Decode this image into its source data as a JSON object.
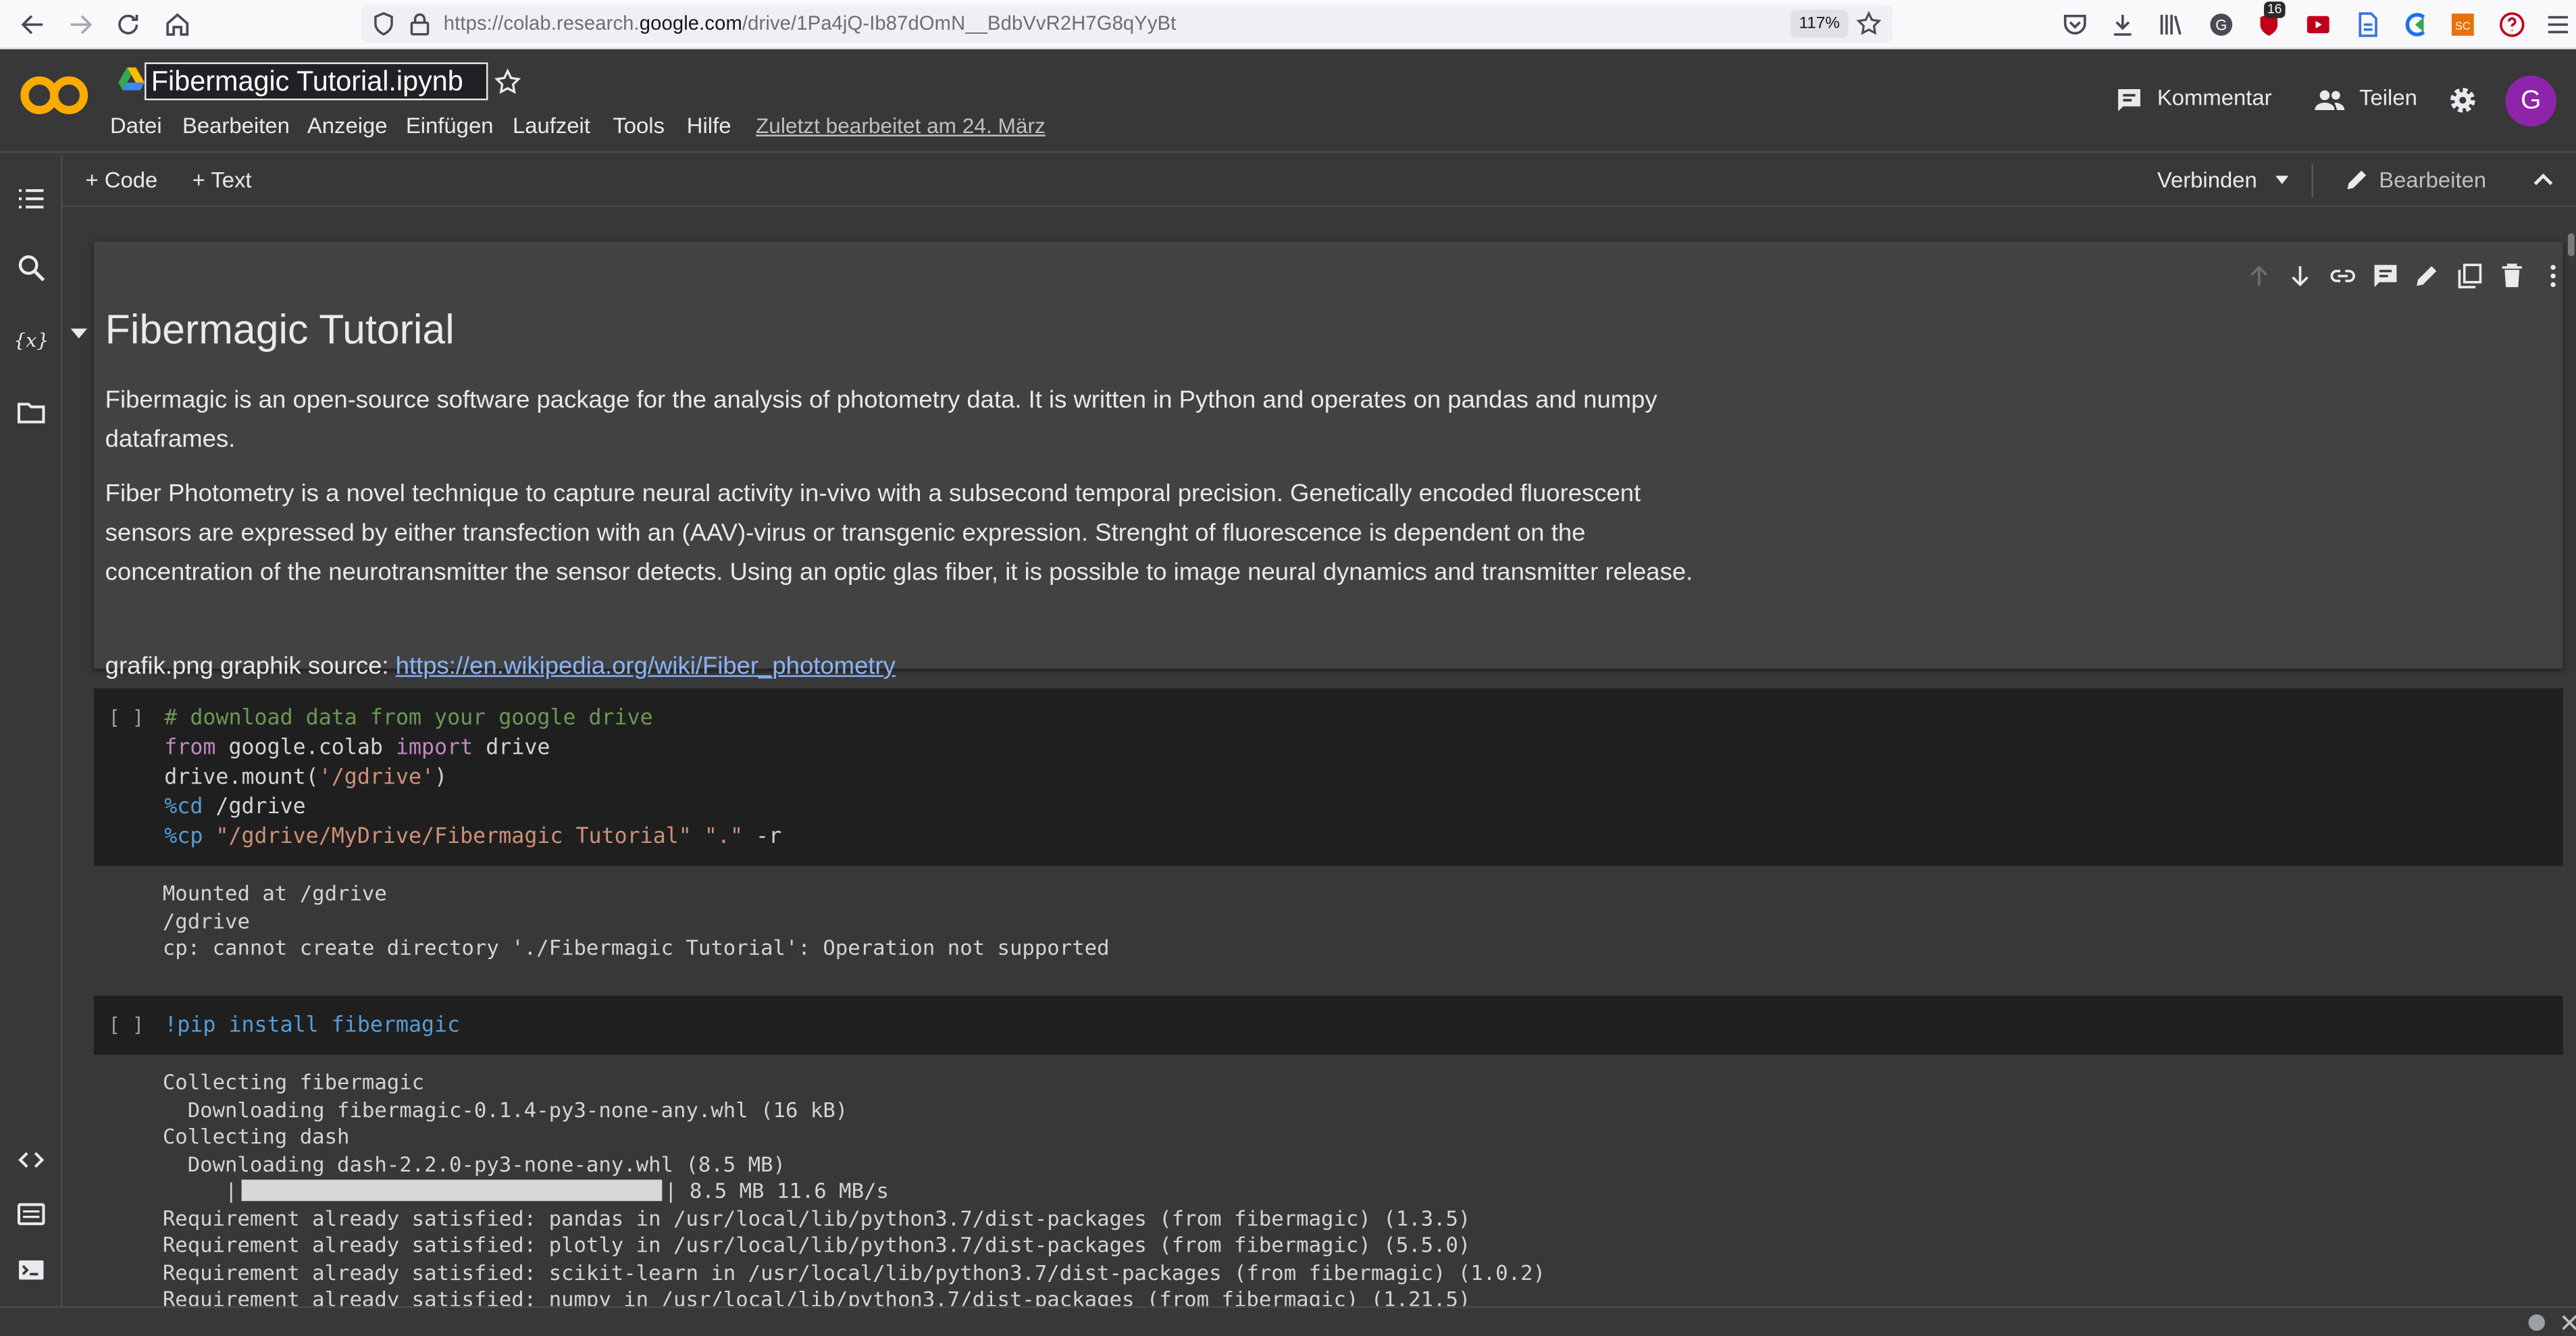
{
  "browser": {
    "url_prefix": "https://colab.research.",
    "url_domain": "google.com",
    "url_path": "/drive/1Pa4jQ-Ib87dOmN__BdbVvR2H7G8qYyBt",
    "zoom": "117%",
    "badge_count": "16"
  },
  "header": {
    "logo_text": "CO",
    "title": "Fibermagic Tutorial.ipynb",
    "menu": [
      "Datei",
      "Bearbeiten",
      "Anzeige",
      "Einfügen",
      "Laufzeit",
      "Tools",
      "Hilfe"
    ],
    "last_edited": "Zuletzt bearbeitet am 24. März",
    "comment_label": "Kommentar",
    "share_label": "Teilen",
    "avatar_letter": "G"
  },
  "toolbar": {
    "add_code": "+ Code",
    "add_text": "+ Text",
    "connect": "Verbinden",
    "edit": "Bearbeiten"
  },
  "text_cell": {
    "heading": "Fibermagic Tutorial",
    "paragraphs": [
      "Fibermagic is an open-source software package for the analysis of photometry data. It is written in Python and operates on pandas and numpy dataframes.",
      "Fiber Photometry is a novel technique to capture neural activity in-vivo with a subsecond temporal precision. Genetically encoded fluorescent sensors are expressed by either transfection with an (AAV)-virus or transgenic expression. Strenght of fluorescence is dependent on the concentration of the neurotransmitter the sensor detects. Using an optic glas fiber, it is possible to image neural dynamics and transmitter release."
    ],
    "source_prefix": "grafik.png graphik source: ",
    "source_link": "https://en.wikipedia.org/wiki/Fiber_photometry"
  },
  "cells": [
    {
      "prompt": "[ ]",
      "code": {
        "comment": "# download data from your google drive",
        "l2_kw1": "from",
        "l2_mid": " google.colab ",
        "l2_kw2": "import",
        "l2_end": " drive",
        "l3_a": "drive.mount(",
        "l3_str": "'/gdrive'",
        "l3_b": ")",
        "l4_mag": "%cd",
        "l4_rest": " /gdrive",
        "l5_mag": "%cp",
        "l5_sp": " ",
        "l5_str1": "\"/gdrive/MyDrive/Fibermagic Tutorial\"",
        "l5_sp2": " ",
        "l5_str2": "\".\"",
        "l5_rest": " -r"
      },
      "output": [
        "Mounted at /gdrive",
        "/gdrive",
        "cp: cannot create directory './Fibermagic Tutorial': Operation not supported"
      ]
    },
    {
      "prompt": "[ ]",
      "code_line": "!pip install fibermagic",
      "output": [
        "Collecting fibermagic",
        "  Downloading fibermagic-0.1.4-py3-none-any.whl (16 kB)",
        "Collecting dash",
        "  Downloading dash-2.2.0-py3-none-any.whl (8.5 MB)"
      ],
      "progress_prefix": "     |",
      "progress_suffix": "| 8.5 MB 11.6 MB/s",
      "progress_fraction": 1.0,
      "output_after": [
        "Requirement already satisfied: pandas in /usr/local/lib/python3.7/dist-packages (from fibermagic) (1.3.5)",
        "Requirement already satisfied: plotly in /usr/local/lib/python3.7/dist-packages (from fibermagic) (5.5.0)",
        "Requirement already satisfied: scikit-learn in /usr/local/lib/python3.7/dist-packages (from fibermagic) (1.0.2)",
        "Requirement already satisfied: numpy in /usr/local/lib/python3.7/dist-packages (from fibermagic) (1.21.5)"
      ]
    }
  ],
  "colors": {
    "background": "#383838",
    "cell": "#424242",
    "code": "#1f1f1f",
    "link": "#8ab4f8",
    "avatar": "#8e24aa",
    "logo": "#f9ab00"
  }
}
